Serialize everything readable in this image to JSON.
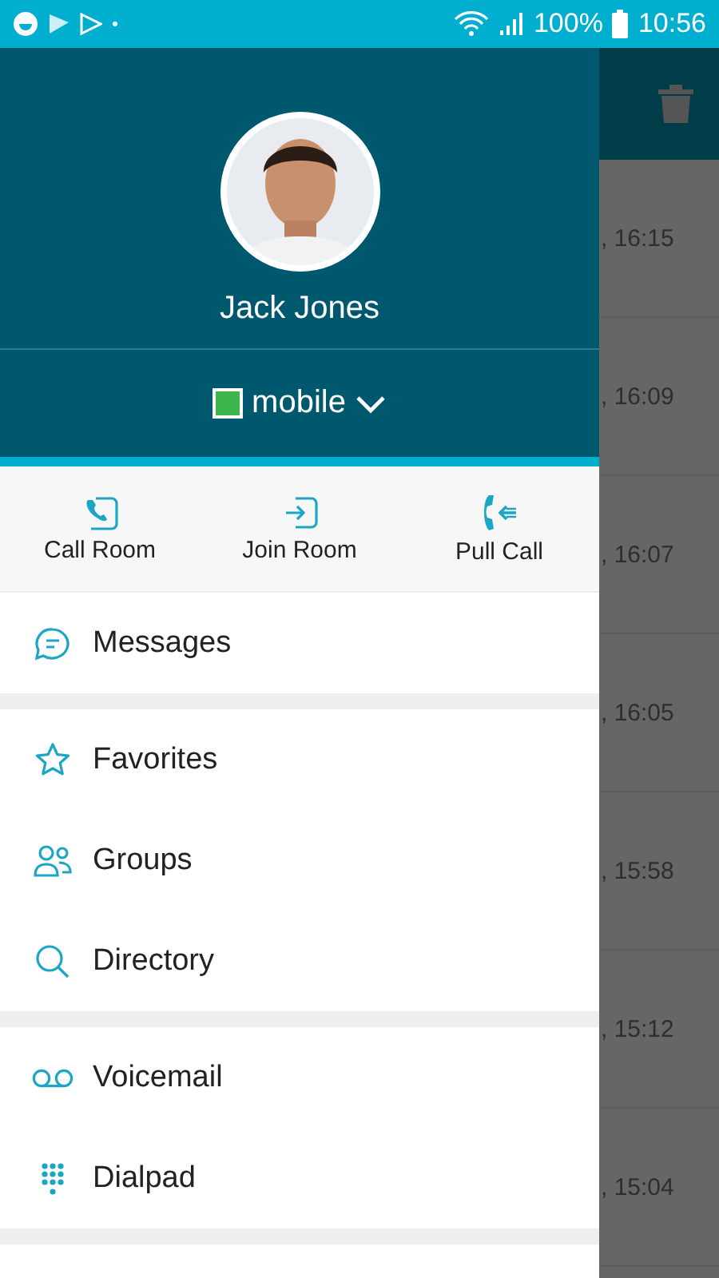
{
  "status_bar": {
    "battery": "100%",
    "time": "10:56"
  },
  "background_list": {
    "timestamps": [
      ", 16:15",
      ", 16:09",
      ", 16:07",
      ", 16:05",
      ", 15:58",
      ", 15:12",
      ", 15:04"
    ]
  },
  "drawer": {
    "user_name": "Jack Jones",
    "presence": {
      "label": "mobile",
      "color": "#3cb54a"
    },
    "actions": [
      "Call Room",
      "Join Room",
      "Pull Call"
    ],
    "sections": [
      [
        {
          "label": "Messages"
        }
      ],
      [
        {
          "label": "Favorites"
        },
        {
          "label": "Groups"
        },
        {
          "label": "Directory"
        }
      ],
      [
        {
          "label": "Voicemail"
        },
        {
          "label": "Dialpad"
        }
      ]
    ]
  }
}
